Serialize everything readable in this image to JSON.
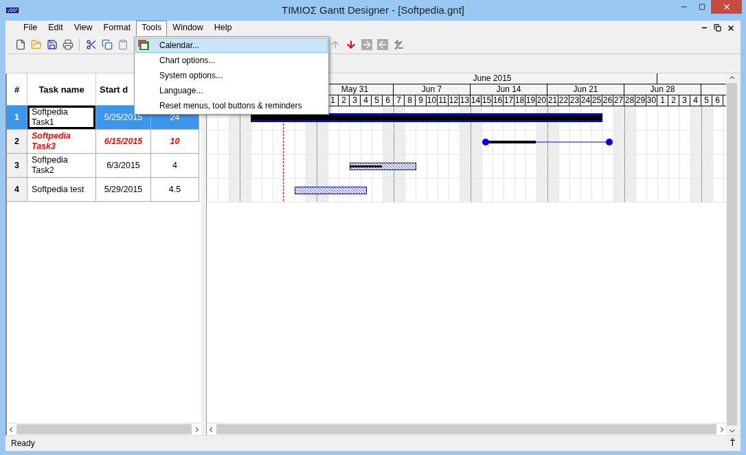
{
  "window": {
    "title": "TIMIOΣ Gantt Designer - [Softpedia.gnt]"
  },
  "menu": [
    {
      "label": "File",
      "selected": false
    },
    {
      "label": "Edit",
      "selected": false
    },
    {
      "label": "View",
      "selected": false
    },
    {
      "label": "Format",
      "selected": false
    },
    {
      "label": "Tools",
      "selected": true
    },
    {
      "label": "Window",
      "selected": false
    },
    {
      "label": "Help",
      "selected": false
    }
  ],
  "tools_menu": [
    {
      "label": "Calendar...",
      "selected": true
    },
    {
      "label": "Chart options...",
      "selected": false
    },
    {
      "label": "System options...",
      "selected": false
    },
    {
      "label": "Language...",
      "selected": false
    },
    {
      "label": "Reset menus, tool buttons & reminders",
      "selected": false
    }
  ],
  "table": {
    "columns": [
      "#",
      "Task name",
      "Start d"
    ],
    "rows": [
      {
        "number": "1",
        "name": "Softpedia Task1",
        "start": "5/25/2015",
        "duration": "24",
        "selected": true,
        "critical": false,
        "kind": "summary",
        "level": 1
      },
      {
        "number": "2",
        "name": "Softpedia Task3",
        "start": "6/15/2015",
        "duration": "10",
        "selected": false,
        "critical": true,
        "kind": "range",
        "level": 0.38
      },
      {
        "number": "3",
        "name": "Softpedia Task2",
        "start": "6/3/2015",
        "duration": "4",
        "selected": false,
        "critical": false,
        "kind": "task",
        "level": 0.48
      },
      {
        "number": "4",
        "name": "Softpedia test",
        "start": "5/29/2015",
        "duration": "4.5",
        "selected": false,
        "critical": false,
        "kind": "task"
      }
    ]
  },
  "timeline": {
    "month": "June 2015",
    "weeks": [
      "May 31",
      "Jun 7",
      "Jun 14",
      "Jun 21",
      "Jun 28"
    ],
    "days": [
      "1",
      "2",
      "3",
      "4",
      "5",
      "6",
      "7",
      "8",
      "9",
      "10",
      "11",
      "12",
      "13",
      "14",
      "15",
      "16",
      "17",
      "18",
      "19",
      "20",
      "21",
      "22",
      "23",
      "24",
      "25",
      "26",
      "27",
      "28",
      "29",
      "30",
      "1",
      "2",
      "3",
      "4",
      "5",
      "6"
    ]
  },
  "status_bar": {
    "text": "Ready",
    "indicator": "Ť"
  }
}
